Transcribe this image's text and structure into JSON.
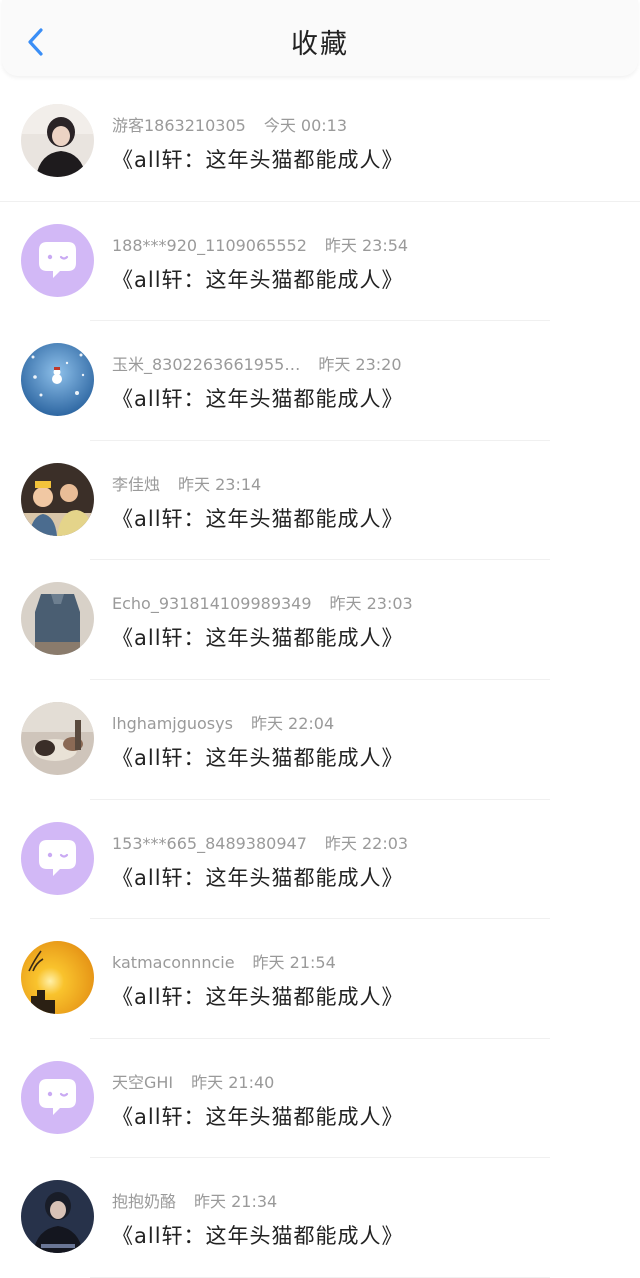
{
  "header": {
    "title": "收藏",
    "back_icon": "chevron-left-icon",
    "accent": "#3a8ef6"
  },
  "items": [
    {
      "user": "游客1863210305",
      "time": "今天 00:13",
      "post": "《all轩：这年头猫都能成人》",
      "avatar": "photo-person"
    },
    {
      "user": "188***920_1109065552",
      "time": "昨天 23:54",
      "post": "《all轩：这年头猫都能成人》",
      "avatar": "default-chat-avatar"
    },
    {
      "user": "玉米_8302263661955…",
      "time": "昨天 23:20",
      "post": "《all轩：这年头猫都能成人》",
      "avatar": "snow-avatar"
    },
    {
      "user": "李佳烛",
      "time": "昨天 23:14",
      "post": "《all轩：这年头猫都能成人》",
      "avatar": "photo-kids"
    },
    {
      "user": "Echo_931814109989349",
      "time": "昨天 23:03",
      "post": "《all轩：这年头猫都能成人》",
      "avatar": "photo-clothes"
    },
    {
      "user": "lhghamjguosys",
      "time": "昨天 22:04",
      "post": "《all轩：这年头猫都能成人》",
      "avatar": "photo-dog"
    },
    {
      "user": "153***665_8489380947",
      "time": "昨天 22:03",
      "post": "《all轩：这年头猫都能成人》",
      "avatar": "default-chat-avatar"
    },
    {
      "user": "katmaconnncie",
      "time": "昨天 21:54",
      "post": "《all轩：这年头猫都能成人》",
      "avatar": "sunset-avatar"
    },
    {
      "user": "天空GHI",
      "time": "昨天 21:40",
      "post": "《all轩：这年头猫都能成人》",
      "avatar": "default-chat-avatar"
    },
    {
      "user": "抱抱奶酪",
      "time": "昨天 21:34",
      "post": "《all轩：这年头猫都能成人》",
      "avatar": "photo-person-dark"
    }
  ]
}
